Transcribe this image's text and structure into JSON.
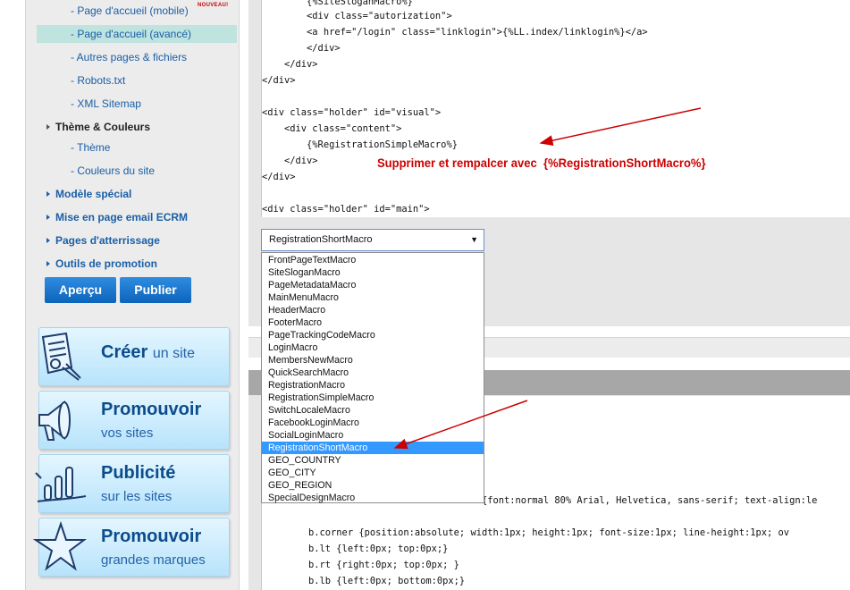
{
  "sidebar": {
    "items": [
      {
        "label": "- Page d'accueil (mobile)",
        "badge": "NOUVEAU!"
      },
      {
        "label": "- Page d'accueil (avancé)"
      },
      {
        "label": "- Autres pages & fichiers"
      },
      {
        "label": "- Robots.txt"
      },
      {
        "label": "- XML Sitemap"
      },
      {
        "label": "Thème & Couleurs"
      },
      {
        "label": "- Thème"
      },
      {
        "label": "- Couleurs du site"
      },
      {
        "label": "Modèle spécial"
      },
      {
        "label": "Mise en page email ECRM"
      },
      {
        "label": "Pages d'atterrissage"
      },
      {
        "label": "Outils de promotion"
      }
    ],
    "buttons": {
      "preview": "Aperçu",
      "publish": "Publier"
    },
    "promos": [
      {
        "title": "Créer",
        "title_suffix": "un site",
        "subtitle": ""
      },
      {
        "title": "Promouvoir",
        "subtitle": "vos sites"
      },
      {
        "title": "Publicité",
        "subtitle": "sur les sites"
      },
      {
        "title": "Promouvoir",
        "subtitle": "grandes marques"
      }
    ]
  },
  "code_top": [
    "        {%SiteSloganMacro%}",
    "        <div class=\"autorization\">",
    "        <a href=\"/login\" class=\"linklogin\">{%LL.index/linklogin%}</a>",
    "        </div>",
    "    </div>",
    "</div>",
    "",
    "<div class=\"holder\" id=\"visual\">",
    "    <div class=\"content\">",
    "        {%RegistrationSimpleMacro%}",
    "    </div>",
    "</div>",
    "",
    "<div class=\"holder\" id=\"main\">"
  ],
  "annotation": "Supprimer et rempalcer avec  {%RegistrationShortMacro%}",
  "select": {
    "value": "RegistrationShortMacro",
    "options": [
      "FrontPageTextMacro",
      "SiteSloganMacro",
      "PageMetadataMacro",
      "MainMenuMacro",
      "HeaderMacro",
      "FooterMacro",
      "PageTrackingCodeMacro",
      "LoginMacro",
      "MembersNewMacro",
      "QuickSearchMacro",
      "RegistrationMacro",
      "RegistrationSimpleMacro",
      "SwitchLocaleMacro",
      "FacebookLoginMacro",
      "SocialLoginMacro",
      "RegistrationShortMacro",
      "GEO_COUNTRY",
      "GEO_CITY",
      "GEO_REGION",
      "SpecialDesignMacro"
    ],
    "highlighted": "RegistrationShortMacro"
  },
  "code_bottom": [
    "{font:normal 80% Arial, Helvetica, sans-serif; text-align:le",
    "",
    "    b.corner {position:absolute; width:1px; height:1px; font-size:1px; line-height:1px; ov",
    "    b.lt {left:0px; top:0px;}",
    "    b.rt {right:0px; top:0px; }",
    "    b.lb {left:0px; bottom:0px;}"
  ],
  "colors": {
    "accent": "#1a5fa6",
    "annotation": "#cc0000",
    "selection": "#3399ff"
  }
}
